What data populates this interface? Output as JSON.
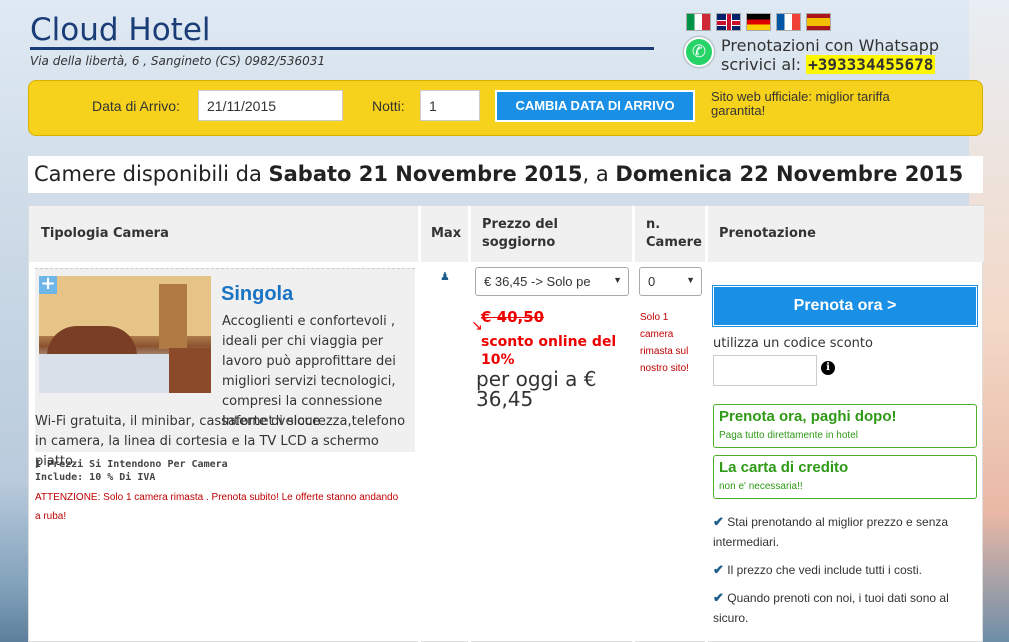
{
  "header": {
    "hotel_name": "Cloud Hotel",
    "address": "Via della libertà, 6 , Sangineto (CS) 0982/536031",
    "whatsapp_line1": "Prenotazioni con Whatsapp",
    "whatsapp_line2": "scrivici al:",
    "whatsapp_phone": "+393334455678",
    "flags": [
      "italian-flag-icon",
      "uk-flag-icon",
      "german-flag-icon",
      "french-flag-icon",
      "spanish-flag-icon"
    ]
  },
  "datebar": {
    "arrival_label": "Data di Arrivo:",
    "arrival_value": "21/11/2015",
    "nights_label": "Notti:",
    "nights_value": "1",
    "change_button": "CAMBIA DATA DI ARRIVO",
    "official_text": "Sito web ufficiale: miglior tariffa garantita!"
  },
  "availability": {
    "prefix": "Camere disponibili da ",
    "from": "Sabato 21 Novembre 2015",
    "middle": ", a ",
    "to": "Domenica 22 Novembre 2015"
  },
  "table": {
    "headers": {
      "room_type": "Tipologia Camera",
      "max": "Max",
      "price": "Prezzo del soggiorno",
      "n_rooms": "n. Camere",
      "booking": "Prenotazione"
    }
  },
  "room": {
    "name": "Singola",
    "desc_right": "Accoglienti e confortevoli , ideali per chi viaggia per lavoro può approfittare dei migliori servizi tecnologici, compresi la connessione Internet veloce",
    "desc_full": "Wi-Fi gratuita, il minibar, cassaforte di sicurezza,telefono in camera, la linea di cortesia e la TV LCD a schermo piatto.",
    "price_note_1": "I Prezzi Si Intendono Per Camera",
    "price_note_2": "Include: 10 % Di IVA",
    "warning": "ATTENZIONE: Solo 1 camera rimasta . Prenota subito! Le offerte stanno andando a ruba!",
    "price_select": "€ 36,45 -> Solo pe",
    "old_price": "€ 40,50",
    "discount": "sconto online del 10%",
    "today_price": "per oggi a € 36,45",
    "rooms_select": "0",
    "rooms_left": "Solo 1 camera rimasta sul nostro sito!"
  },
  "booking": {
    "book_button": "Prenota ora >",
    "discount_code_label": "utilizza un codice sconto",
    "discount_code_value": "",
    "pay_later_title": "Prenota ora, paghi dopo!",
    "pay_later_sub": "Paga tutto direttamente in hotel",
    "card_title": "La carta di credito",
    "card_sub": "non e' necessaria!!",
    "benefit_1": "Stai prenotando al miglior prezzo e senza intermediari.",
    "benefit_2": "Il prezzo che vedi include tutti i costi.",
    "benefit_3": "Quando prenoti con noi, i tuoi dati sono al sicuro."
  }
}
